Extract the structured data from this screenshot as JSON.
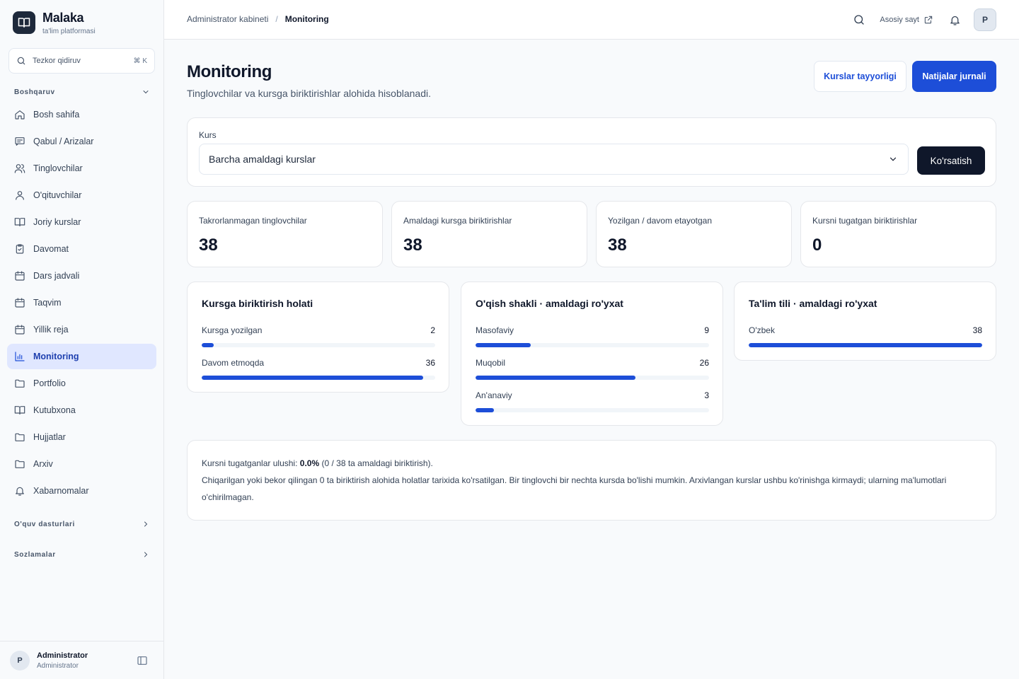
{
  "brand": {
    "name": "Malaka",
    "subtitle": "ta'lim platformasi"
  },
  "sidebar": {
    "search_placeholder": "Tezkor qidiruv",
    "search_shortcut": "⌘ K",
    "group_main": "Boshqaruv",
    "items": [
      {
        "label": "Bosh sahifa",
        "icon": "home-icon"
      },
      {
        "label": "Qabul / Arizalar",
        "icon": "message-icon"
      },
      {
        "label": "Tinglovchilar",
        "icon": "users-icon"
      },
      {
        "label": "O'qituvchilar",
        "icon": "user-icon"
      },
      {
        "label": "Joriy kurslar",
        "icon": "book-icon"
      },
      {
        "label": "Davomat",
        "icon": "clipboard-icon"
      },
      {
        "label": "Dars jadvali",
        "icon": "calendar-icon"
      },
      {
        "label": "Taqvim",
        "icon": "calendar-icon"
      },
      {
        "label": "Yillik reja",
        "icon": "calendar-icon"
      },
      {
        "label": "Monitoring",
        "icon": "chart-icon"
      },
      {
        "label": "Portfolio",
        "icon": "folder-icon"
      },
      {
        "label": "Kutubxona",
        "icon": "book-icon"
      },
      {
        "label": "Hujjatlar",
        "icon": "folder-icon"
      },
      {
        "label": "Arxiv",
        "icon": "folder-icon"
      },
      {
        "label": "Xabarnomalar",
        "icon": "bell-icon"
      }
    ],
    "active_item": "Monitoring",
    "group_programs": "O'quv dasturlari",
    "group_settings": "Sozlamalar",
    "user": {
      "initial": "P",
      "name": "Administrator",
      "role": "Administrator"
    }
  },
  "topbar": {
    "breadcrumb_root": "Administrator kabineti",
    "breadcrumb_separator": "/",
    "breadcrumb_current": "Monitoring",
    "site_link": "Asosiy sayt",
    "avatar_initial": "P"
  },
  "header": {
    "title": "Monitoring",
    "subtitle": "Tinglovchilar va kursga biriktirishlar alohida hisoblanadi.",
    "btn_readiness": "Kurslar tayyorligi",
    "btn_journal": "Natijalar jurnali"
  },
  "filter": {
    "label": "Kurs",
    "selected": "Barcha amaldagi kurslar",
    "button": "Ko'rsatish"
  },
  "stats": [
    {
      "label": "Takrorlanmagan tinglovchilar",
      "value": "38"
    },
    {
      "label": "Amaldagi kursga biriktirishlar",
      "value": "38"
    },
    {
      "label": "Yozilgan / davom etayotgan",
      "value": "38"
    },
    {
      "label": "Kursni tugatgan biriktirishlar",
      "value": "0"
    }
  ],
  "breakdowns": [
    {
      "title": "Kursga biriktirish holati",
      "rows": [
        {
          "label": "Kursga yozilgan",
          "value": 2,
          "fraction": 0.053
        },
        {
          "label": "Davom etmoqda",
          "value": 36,
          "fraction": 0.947
        }
      ]
    },
    {
      "title": "O'qish shakli · amaldagi ro'yxat",
      "rows": [
        {
          "label": "Masofaviy",
          "value": 9,
          "fraction": 0.237
        },
        {
          "label": "Muqobil",
          "value": 26,
          "fraction": 0.684
        },
        {
          "label": "An'anaviy",
          "value": 3,
          "fraction": 0.079
        }
      ]
    },
    {
      "title": "Ta'lim tili · amaldagi ro'yxat",
      "rows": [
        {
          "label": "O'zbek",
          "value": 38,
          "fraction": 1.0
        }
      ]
    }
  ],
  "note": {
    "line1_prefix": "Kursni tugatganlar ulushi:",
    "line1_value": "0.0%",
    "line1_suffix": "(0 / 38 ta amaldagi biriktirish).",
    "line2": "Chiqarilgan yoki bekor qilingan 0 ta biriktirish alohida holatlar tarixida ko'rsatilgan. Bir tinglovchi bir nechta kursda bo'lishi mumkin. Arxivlangan kurslar ushbu ko'rinishga kirmaydi; ularning ma'lumotlari o'chirilmagan."
  },
  "colors": {
    "accent": "#1d4ed8",
    "active_bg": "#e0e7ff",
    "dark_button": "#0f172a"
  }
}
